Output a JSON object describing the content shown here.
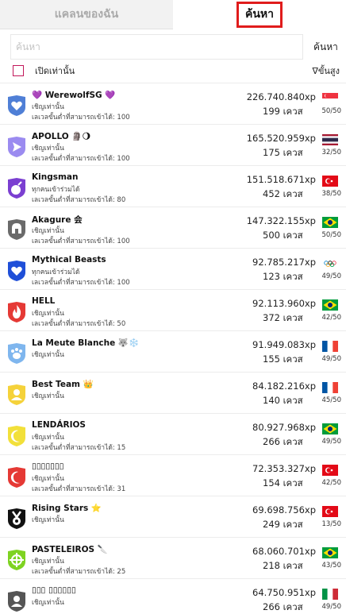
{
  "tabs": {
    "my_clan": "แคลนของฉัน",
    "search": "ค้นหา"
  },
  "search": {
    "placeholder": "ค้นหา",
    "button": "ค้นหา"
  },
  "filter": {
    "open_only": "เปิดเท่านั้น",
    "sort": "∇ขั้นสูง"
  },
  "clans": [
    {
      "name": "💜 WerewolfSG 💜",
      "type": "เชิญเท่านั้น",
      "req": "เลเวลขั้นต่ำที่สามารถเข้าได้: 100",
      "xp": "226.740.840xp",
      "members": "199 เควส",
      "count": "50/50",
      "flag": "Singapore",
      "badge": "heart",
      "color": "#4f7fd6"
    },
    {
      "name": "APOLLO 🗿🌖",
      "type": "เชิญเท่านั้น",
      "req": "เลเวลขั้นต่ำที่สามารถเข้าได้: 100",
      "xp": "165.520.959xp",
      "members": "175 เควส",
      "count": "32/50",
      "flag": "Thailand",
      "badge": "arrow",
      "color": "#9b8bf0"
    },
    {
      "name": "Kingsman",
      "type": "ทุกคนเข้าร่วมได้",
      "req": "เลเวลขั้นต่ำที่สามารถเข้าได้: 80",
      "xp": "151.518.671xp",
      "members": "452 เควส",
      "count": "38/50",
      "flag": "Turkey",
      "badge": "bomb",
      "color": "#7b3fd1"
    },
    {
      "name": "Akagure 会",
      "type": "เชิญเท่านั้น",
      "req": "เลเวลขั้นต่ำที่สามารถเข้าได้: 100",
      "xp": "147.322.155xp",
      "members": "500 เควส",
      "count": "50/50",
      "flag": "Brazil",
      "badge": "helmet",
      "color": "#6a6a6a"
    },
    {
      "name": "Mythical Beasts",
      "type": "ทุกคนเข้าร่วมได้",
      "req": "เลเวลขั้นต่ำที่สามารถเข้าได้: 100",
      "xp": "92.785.217xp",
      "members": "123 เควส",
      "count": "49/50",
      "flag": "Olympic",
      "badge": "heart",
      "color": "#1f4fd8"
    },
    {
      "name": "HELL",
      "type": "เชิญเท่านั้น",
      "req": "เลเวลขั้นต่ำที่สามารถเข้าได้: 50",
      "xp": "92.113.960xp",
      "members": "372 เควส",
      "count": "42/50",
      "flag": "Brazil",
      "badge": "fire",
      "color": "#e53935"
    },
    {
      "name": "La Meute Blanche 🐺❄️",
      "type": "เชิญเท่านั้น",
      "req": "",
      "xp": "91.949.083xp",
      "members": "155 เควส",
      "count": "49/50",
      "flag": "France",
      "badge": "paw",
      "color": "#7fb6ee"
    },
    {
      "name": "Best Team 👑",
      "type": "เชิญเท่านั้น",
      "req": "",
      "xp": "84.182.216xp",
      "members": "140 เควส",
      "count": "45/50",
      "flag": "France",
      "badge": "person",
      "color": "#f5d23a"
    },
    {
      "name": "LENDÁRIOS",
      "type": "เชิญเท่านั้น",
      "req": "เลเวลขั้นต่ำที่สามารถเข้าได้: 15",
      "xp": "80.927.968xp",
      "members": "266 เควส",
      "count": "49/50",
      "flag": "Brazil",
      "badge": "moon",
      "color": "#f2e03a"
    },
    {
      "name": "▯▯▯▯▯▯▯",
      "type": "เชิญเท่านั้น",
      "req": "เลเวลขั้นต่ำที่สามารถเข้าได้: 31",
      "xp": "72.353.327xp",
      "members": "154 เควส",
      "count": "42/50",
      "flag": "Turkey",
      "badge": "moon",
      "color": "#e53935"
    },
    {
      "name": "Rising Stars ⭐",
      "type": "เชิญเท่านั้น",
      "req": "",
      "xp": "69.698.756xp",
      "members": "249 เควส",
      "count": "13/50",
      "flag": "Turkey",
      "badge": "medal",
      "color": "#111111"
    },
    {
      "name": "PASTELEIROS 🔪",
      "type": "เชิญเท่านั้น",
      "req": "เลเวลขั้นต่ำที่สามารถเข้าได้: 25",
      "xp": "68.060.701xp",
      "members": "218 เควส",
      "count": "43/50",
      "flag": "Brazil",
      "badge": "target",
      "color": "#7ed321"
    },
    {
      "name": "▯▯▯ ▯▯▯▯▯▯",
      "type": "เชิญเท่านั้น",
      "req": "",
      "xp": "64.750.951xp",
      "members": "266 เควส",
      "count": "49/50",
      "flag": "Italy",
      "badge": "person",
      "color": "#555555"
    }
  ]
}
